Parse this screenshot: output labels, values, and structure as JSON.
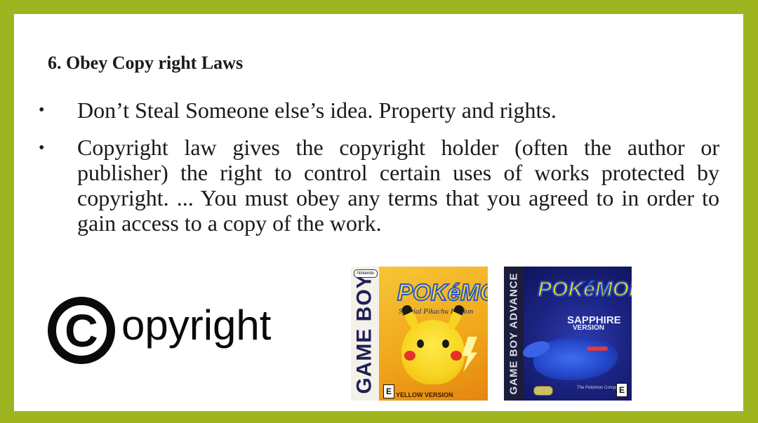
{
  "slide": {
    "title": "6. Obey Copy right Laws",
    "bullets": [
      "Don’t Steal Someone else’s idea. Property and rights.",
      "Copyright law gives the copyright holder (often the author or publisher) the right to control certain uses of works protected by copyright. ... You must obey any terms that you agreed to in order to gain access to a copy of the work."
    ],
    "bullet_marker": "•"
  },
  "copyright_logo": {
    "symbol": "C",
    "word": "opyright"
  },
  "game_boxes": [
    {
      "spine_text": "GAME BOY",
      "publisher_badge": "Nintendo",
      "title": "POKéMON",
      "edition": "Special Pikachu Edition",
      "version": "YELLOW VERSION",
      "rating": "E"
    },
    {
      "spine_text": "GAME BOY ADVANCE",
      "title": "POKéMON",
      "edition": "SAPPHIRE",
      "version": "VERSION",
      "company": "The Pokémon Company",
      "rating": "E"
    }
  ],
  "colors": {
    "frame": "#9fb51f",
    "slide_background": "#ffffff",
    "text": "#1a1a1a"
  }
}
